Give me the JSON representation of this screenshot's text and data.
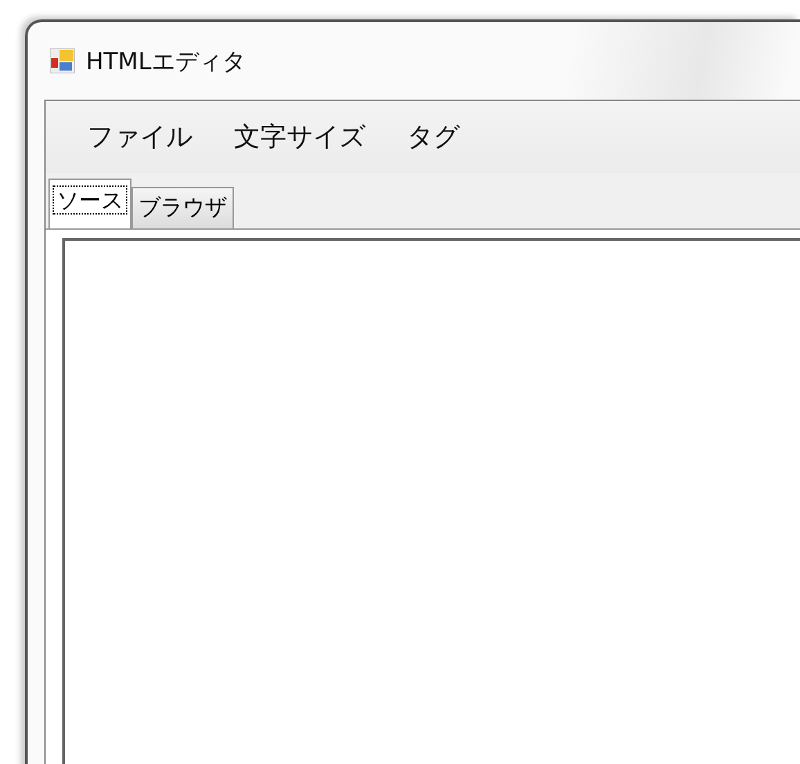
{
  "window": {
    "title": "HTMLエディタ"
  },
  "menu": [
    "ファイル",
    "文字サイズ",
    "タグ"
  ],
  "tabs": [
    {
      "label": "ソース",
      "selected": true
    },
    {
      "label": "ブラウザ",
      "selected": false
    }
  ]
}
